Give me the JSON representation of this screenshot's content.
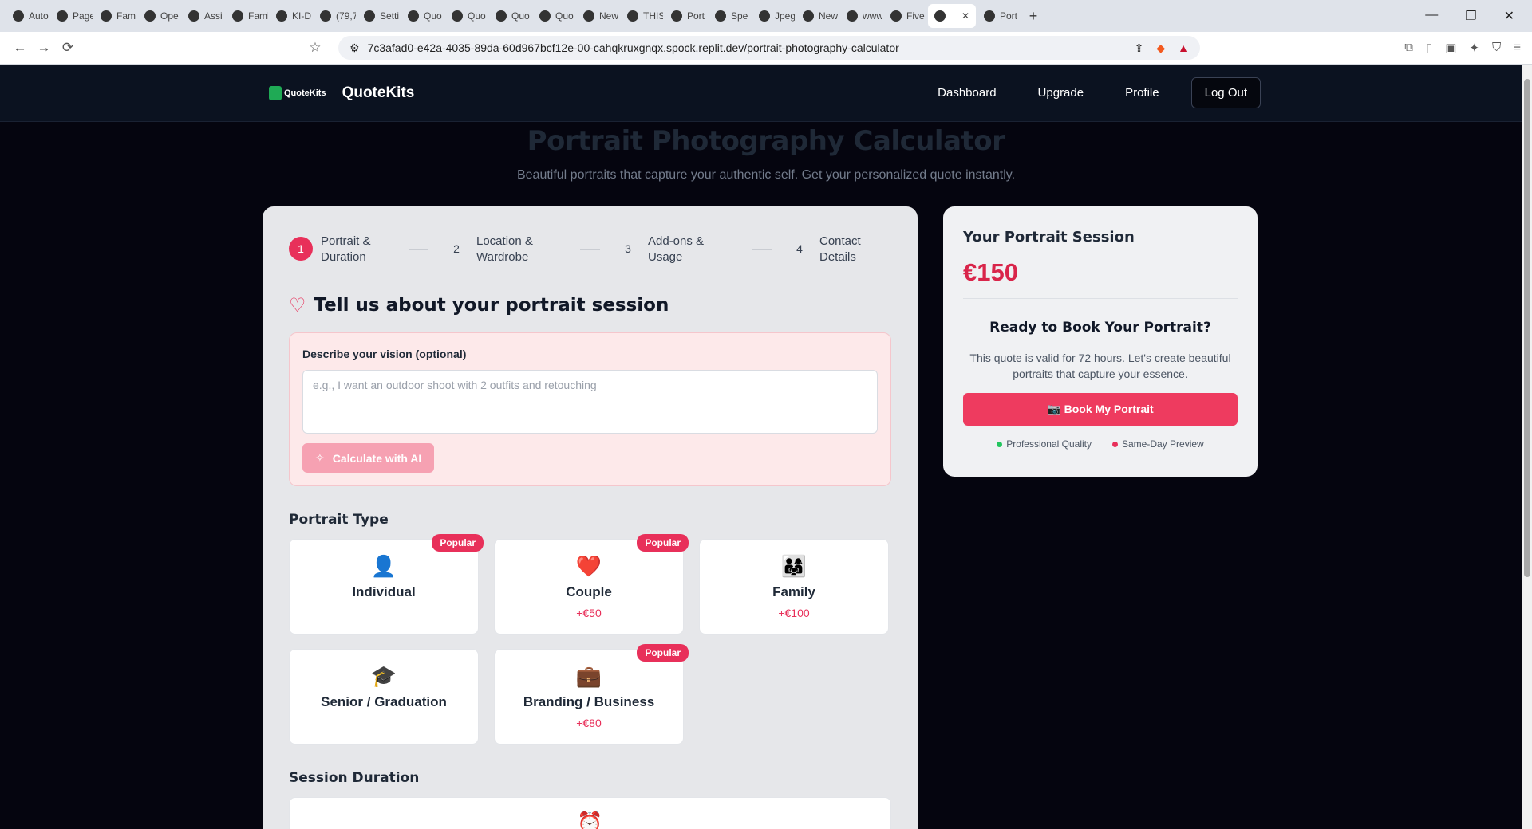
{
  "browser": {
    "tabs": [
      "Auto",
      "Page",
      "Fami",
      "Ope",
      "Assi",
      "Fami",
      "KI-D",
      "(79,7",
      "Setti",
      "Quo",
      "Quo",
      "Quo",
      "Quo",
      "New",
      "THIS",
      "Port",
      "Spe",
      "Jpeg",
      "New",
      "www",
      "Five",
      "",
      "Port"
    ],
    "url": "7c3afad0-e42a-4035-89da-60d967bcf12e-00-cahqkruxgnqx.spock.replit.dev/portrait-photography-calculator"
  },
  "header": {
    "logo_text": "QuoteKits",
    "brand": "QuoteKits",
    "nav": [
      "Dashboard",
      "Upgrade",
      "Profile"
    ],
    "logout": "Log Out"
  },
  "hero": {
    "title": "Portrait Photography Calculator",
    "subtitle": "Beautiful portraits that capture your authentic self. Get your personalized quote instantly."
  },
  "steps": [
    {
      "num": "1",
      "label": "Portrait & Duration"
    },
    {
      "num": "2",
      "label": "Location & Wardrobe"
    },
    {
      "num": "3",
      "label": "Add-ons & Usage"
    },
    {
      "num": "4",
      "label": "Contact Details"
    }
  ],
  "form": {
    "section_title": "Tell us about your portrait session",
    "vision_label": "Describe your vision (optional)",
    "vision_placeholder": "e.g., I want an outdoor shoot with 2 outfits and retouching",
    "ai_button": "Calculate with AI",
    "portrait_type_title": "Portrait Type",
    "types": [
      {
        "emoji": "👤",
        "name": "Individual",
        "price": "",
        "badge": "Popular"
      },
      {
        "emoji": "❤️",
        "name": "Couple",
        "price": "+€50",
        "badge": "Popular"
      },
      {
        "emoji": "👨‍👩‍👧",
        "name": "Family",
        "price": "+€100",
        "badge": ""
      },
      {
        "emoji": "🎓",
        "name": "Senior / Graduation",
        "price": "",
        "badge": ""
      },
      {
        "emoji": "💼",
        "name": "Branding / Business",
        "price": "+€80",
        "badge": "Popular"
      }
    ],
    "duration_title": "Session Duration",
    "duration_emoji": "⏰"
  },
  "summary": {
    "title": "Your Portrait Session",
    "price": "€150",
    "ready_title": "Ready to Book Your Portrait?",
    "text": "This quote is valid for 72 hours. Let's create beautiful portraits that capture your essence.",
    "book_button": "📷 Book My Portrait",
    "features": [
      {
        "label": "Professional Quality",
        "color": "#22c55e"
      },
      {
        "label": "Same-Day Preview",
        "color": "#e8305a"
      }
    ]
  }
}
